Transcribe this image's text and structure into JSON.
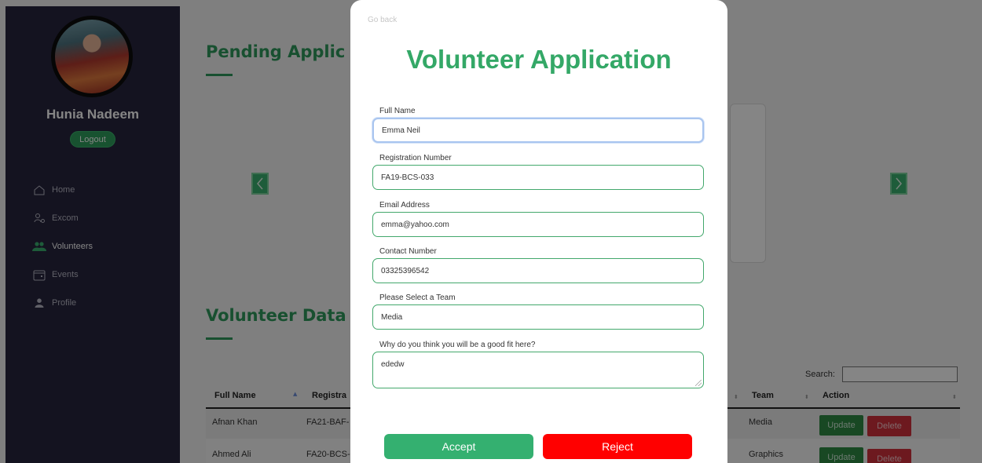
{
  "sidebar": {
    "user_name": "Hunia Nadeem",
    "logout_label": "Logout",
    "nav": [
      {
        "label": "Home",
        "icon": "home-icon"
      },
      {
        "label": "Excom",
        "icon": "users-gear-icon"
      },
      {
        "label": "Volunteers",
        "icon": "users-icon",
        "active": true
      },
      {
        "label": "Events",
        "icon": "calendar-icon"
      },
      {
        "label": "Profile",
        "icon": "user-icon"
      }
    ]
  },
  "main": {
    "pending_title": "Pending Applic",
    "volunteer_data_title": "Volunteer Data",
    "search_label": "Search:",
    "table": {
      "headers": [
        "Full Name",
        "Registra",
        "Team",
        "Action"
      ],
      "rows": [
        {
          "name": "Afnan Khan",
          "reg": "FA21-BAF-",
          "team": "Media",
          "update": "Update",
          "delete": "Delete"
        },
        {
          "name": "Ahmed Ali",
          "reg": "FA20-BCS-",
          "team": "Graphics",
          "update": "Update",
          "delete": "Delete"
        }
      ]
    }
  },
  "modal": {
    "go_back": "Go back",
    "title": "Volunteer Application",
    "fields": {
      "full_name": {
        "label": "Full Name",
        "value": "Emma Neil"
      },
      "registration": {
        "label": "Registration Number",
        "value": "FA19-BCS-033"
      },
      "email": {
        "label": "Email Address",
        "value": "emma@yahoo.com"
      },
      "contact": {
        "label": "Contact Number",
        "value": "03325396542"
      },
      "team": {
        "label": "Please Select a Team",
        "value": "Media"
      },
      "reason": {
        "label": "Why do you think you will be a good fit here?",
        "value": "ededw"
      }
    },
    "accept_label": "Accept",
    "reject_label": "Reject"
  },
  "colors": {
    "accent_green": "#34a867",
    "sidebar_bg": "#27253e",
    "reject_red": "#ff0000",
    "delete_red": "#d1303d"
  }
}
